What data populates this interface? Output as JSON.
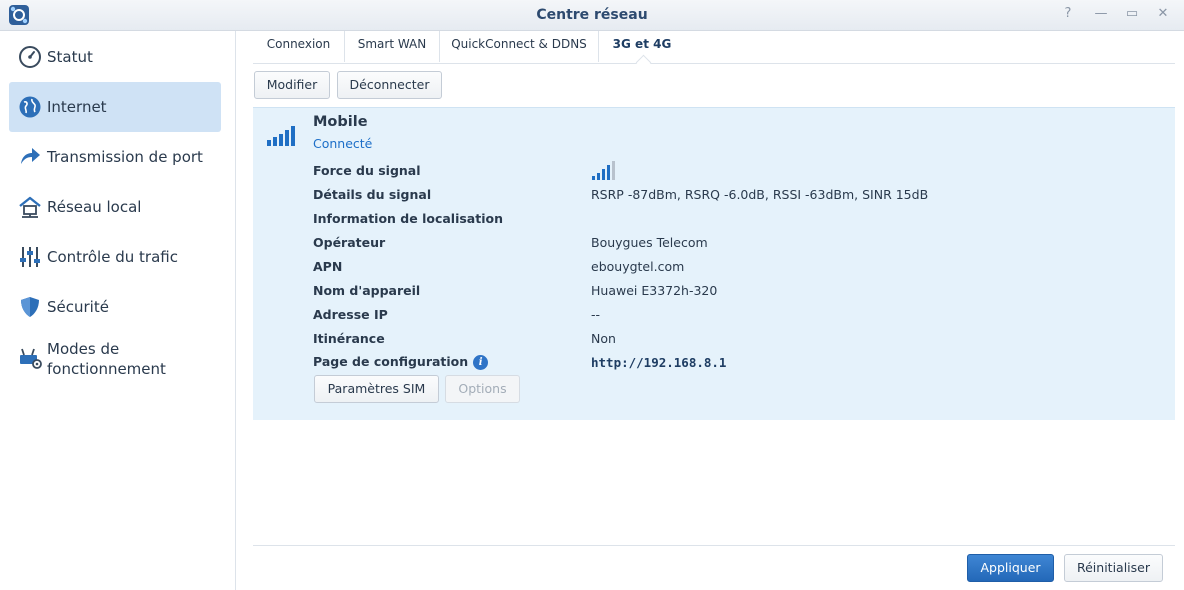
{
  "window": {
    "title": "Centre réseau",
    "controls": {
      "help": "?",
      "minimize": "—",
      "maximize": "▭",
      "close": "✕"
    }
  },
  "sidebar": {
    "items": [
      {
        "label": "Statut",
        "icon": "gauge-icon",
        "active": false
      },
      {
        "label": "Internet",
        "icon": "globe-icon",
        "active": true
      },
      {
        "label": "Transmission de port",
        "icon": "forward-arrow-icon",
        "active": false
      },
      {
        "label": "Réseau local",
        "icon": "home-network-icon",
        "active": false
      },
      {
        "label": "Contrôle du trafic",
        "icon": "sliders-icon",
        "active": false
      },
      {
        "label": "Sécurité",
        "icon": "shield-icon",
        "active": false
      },
      {
        "label": "Modes de",
        "label2": "fonctionnement",
        "icon": "router-gear-icon",
        "active": false
      }
    ]
  },
  "tabs": [
    {
      "label": "Connexion",
      "active": false
    },
    {
      "label": "Smart WAN",
      "active": false
    },
    {
      "label": "QuickConnect & DDNS",
      "active": false
    },
    {
      "label": "3G et 4G",
      "active": true
    }
  ],
  "toolbar": {
    "modify_label": "Modifier",
    "disconnect_label": "Déconnecter"
  },
  "mobile": {
    "title": "Mobile",
    "status": "Connecté",
    "signal_bars_active": 4,
    "signal_bars_total": 5,
    "rows": {
      "signal_strength": {
        "label": "Force du signal"
      },
      "signal_details": {
        "label": "Détails du signal",
        "value": "RSRP -87dBm, RSRQ -6.0dB, RSSI -63dBm, SINR 15dB"
      },
      "location_info": {
        "label": "Information de localisation",
        "value": ""
      },
      "operator": {
        "label": "Opérateur",
        "value": "Bouygues Telecom"
      },
      "apn": {
        "label": "APN",
        "value": "ebouygtel.com"
      },
      "device_name": {
        "label": "Nom d'appareil",
        "value": "Huawei E3372h-320"
      },
      "ip_address": {
        "label": "Adresse IP",
        "value": "--"
      },
      "roaming": {
        "label": "Itinérance",
        "value": "Non"
      },
      "config_page": {
        "label": "Page de configuration",
        "value": "http://192.168.8.1"
      }
    },
    "sim_settings_label": "Paramètres SIM",
    "options_label": "Options"
  },
  "footer": {
    "apply_label": "Appliquer",
    "reset_label": "Réinitialiser"
  },
  "colors": {
    "accent": "#2368b8",
    "active_nav": "#cfe2f5",
    "panel_bg": "#e5f2fb",
    "status_link": "#1d6fc8",
    "signal_on": "#1f6fc4",
    "signal_off": "#b8c2cd"
  }
}
